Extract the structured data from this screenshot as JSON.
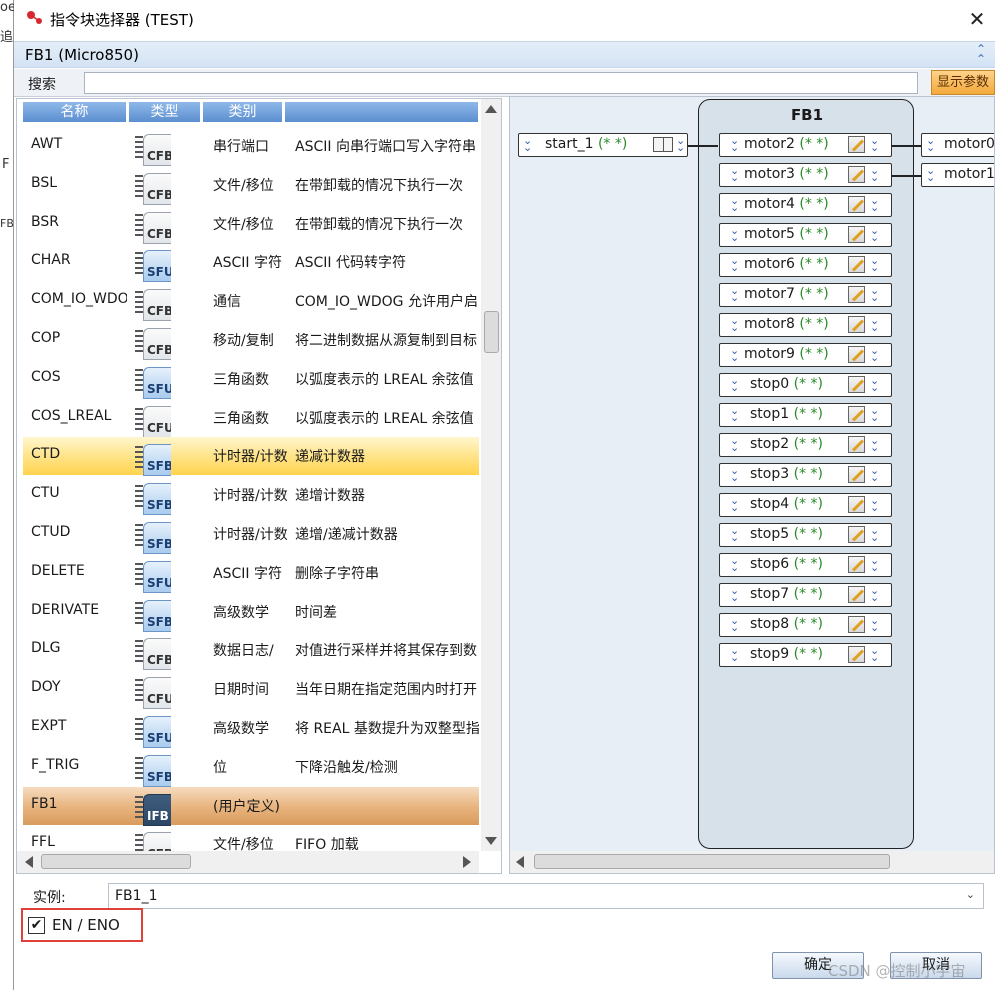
{
  "window": {
    "title": "指令块选择器 (TEST)",
    "close_glyph": "✕"
  },
  "background_window": {
    "fragments": [
      "oe",
      "追",
      "F",
      "FB"
    ]
  },
  "header": {
    "title": "FB1 (Micro850)",
    "collapse_glyph": "⌃"
  },
  "search": {
    "label": "搜索",
    "value": "",
    "show_params_label": "显示参数"
  },
  "list": {
    "columns": {
      "name": "名称",
      "type": "类型",
      "category": "类别",
      "description": ""
    },
    "rows": [
      {
        "name": "AWT",
        "type": "CFB",
        "category": "串行端口",
        "description": "ASCII 向串行端口写入字符串",
        "highlight": ""
      },
      {
        "name": "BSL",
        "type": "CFB",
        "category": "文件/移位",
        "description": "在带卸载的情况下执行一次",
        "highlight": ""
      },
      {
        "name": "BSR",
        "type": "CFB",
        "category": "文件/移位",
        "description": "在带卸载的情况下执行一次",
        "highlight": ""
      },
      {
        "name": "CHAR",
        "type": "SFU",
        "category": "ASCII 字符",
        "description": "ASCII 代码转字符",
        "highlight": ""
      },
      {
        "name": "COM_IO_WDOG",
        "type": "CFB",
        "category": "通信",
        "description": "COM_IO_WDOG 允许用户启",
        "highlight": ""
      },
      {
        "name": "COP",
        "type": "CFB",
        "category": "移动/复制",
        "description": "将二进制数据从源复制到目标",
        "highlight": ""
      },
      {
        "name": "COS",
        "type": "SFU",
        "category": "三角函数",
        "description": "以弧度表示的 LREAL 余弦值",
        "highlight": ""
      },
      {
        "name": "COS_LREAL",
        "type": "CFU",
        "category": "三角函数",
        "description": "以弧度表示的 LREAL 余弦值",
        "highlight": ""
      },
      {
        "name": "CTD",
        "type": "SFB",
        "category": "计时器/计数器",
        "description": "递减计数器",
        "highlight": "yellow"
      },
      {
        "name": "CTU",
        "type": "SFB",
        "category": "计时器/计数器",
        "description": "递增计数器",
        "highlight": ""
      },
      {
        "name": "CTUD",
        "type": "SFB",
        "category": "计时器/计数器",
        "description": "递增/递减计数器",
        "highlight": ""
      },
      {
        "name": "DELETE",
        "type": "SFU",
        "category": "ASCII 字符",
        "description": "删除子字符串",
        "highlight": ""
      },
      {
        "name": "DERIVATE",
        "type": "SFB",
        "category": "高级数学",
        "description": "时间差",
        "highlight": ""
      },
      {
        "name": "DLG",
        "type": "CFB",
        "category": "数据日志/",
        "description": "对值进行采样并将其保存到数",
        "highlight": ""
      },
      {
        "name": "DOY",
        "type": "CFU",
        "category": "日期时间",
        "description": "当年日期在指定范围内时打开",
        "highlight": ""
      },
      {
        "name": "EXPT",
        "type": "SFU",
        "category": "高级数学",
        "description": "将 REAL 基数提升为双整型指",
        "highlight": ""
      },
      {
        "name": "F_TRIG",
        "type": "SFB",
        "category": "位",
        "description": "下降沿触发/检测",
        "highlight": ""
      },
      {
        "name": "FB1",
        "type": "IFB",
        "category": " (用户定义)",
        "description": "",
        "highlight": "orange"
      },
      {
        "name": "FFL",
        "type": "CFB",
        "category": "文件/移位",
        "description": "FIFO 加载",
        "highlight": ""
      }
    ]
  },
  "diagram": {
    "block_title": "FB1",
    "input_pin": {
      "name": "start_1",
      "value": "(*    *)"
    },
    "block_pins": [
      {
        "name": "motor2",
        "value": "(*    *)"
      },
      {
        "name": "motor3",
        "value": "(*    *)"
      },
      {
        "name": "motor4",
        "value": "(*    *)"
      },
      {
        "name": "motor5",
        "value": "(*    *)"
      },
      {
        "name": "motor6",
        "value": "(*    *)"
      },
      {
        "name": "motor7",
        "value": "(*    *)"
      },
      {
        "name": "motor8",
        "value": "(*    *)"
      },
      {
        "name": "motor9",
        "value": "(*    *)"
      },
      {
        "name": "stop0",
        "value": "(*    *)"
      },
      {
        "name": "stop1",
        "value": "(*    *)"
      },
      {
        "name": "stop2",
        "value": "(*    *)"
      },
      {
        "name": "stop3",
        "value": "(*    *)"
      },
      {
        "name": "stop4",
        "value": "(*    *)"
      },
      {
        "name": "stop5",
        "value": "(*    *)"
      },
      {
        "name": "stop6",
        "value": "(*    *)"
      },
      {
        "name": "stop7",
        "value": "(*    *)"
      },
      {
        "name": "stop8",
        "value": "(*    *)"
      },
      {
        "name": "stop9",
        "value": "(*    *)"
      }
    ],
    "output_pins": [
      {
        "name": "motor0"
      },
      {
        "name": "motor1"
      }
    ]
  },
  "bottom": {
    "instance_label": "实例:",
    "instance_value": "FB1_1",
    "en_eno_label": "EN / ENO",
    "en_eno_checked": true,
    "ok_label": "确定",
    "cancel_label": "取消",
    "watermark": "CSDN @控制小宇宙"
  },
  "colors": {
    "highlight_yellow": "#ffd34d",
    "highlight_orange": "#d89b5c",
    "header_blue": "#5b8fd0",
    "annotation_red": "#e0403a"
  }
}
